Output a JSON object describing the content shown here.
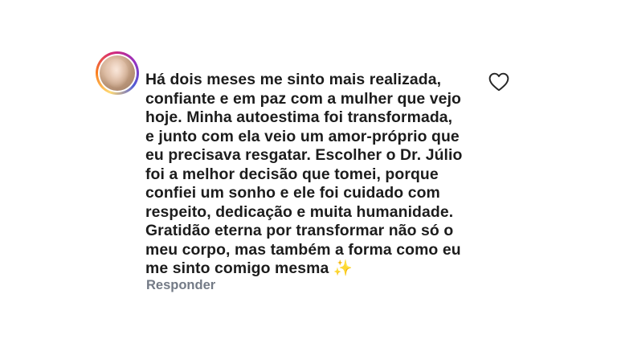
{
  "comment": {
    "lines": [
      "Há dois meses me sinto mais realizada,",
      "confiante e em paz com a mulher que vejo",
      "hoje. Minha autoestima foi transformada,",
      "e junto com ela veio um amor-próprio que",
      "eu precisava resgatar. Escolher o Dr. Júlio",
      "foi a melhor decisão que tomei, porque",
      "confiei um sonho e ele foi cuidado com",
      "respeito, dedicação e muita humanidade.",
      "Gratidão eterna por transformar não só o",
      "meu corpo, mas também a forma como eu",
      "me sinto comigo mesma"
    ],
    "emoji": "✨",
    "reply_label": "Responder"
  },
  "icons": {
    "like": "heart-outline-icon",
    "avatar": "profile-avatar"
  },
  "colors": {
    "text": "#1c1c1c",
    "reply": "#737a86",
    "heart_stroke": "#262626"
  }
}
